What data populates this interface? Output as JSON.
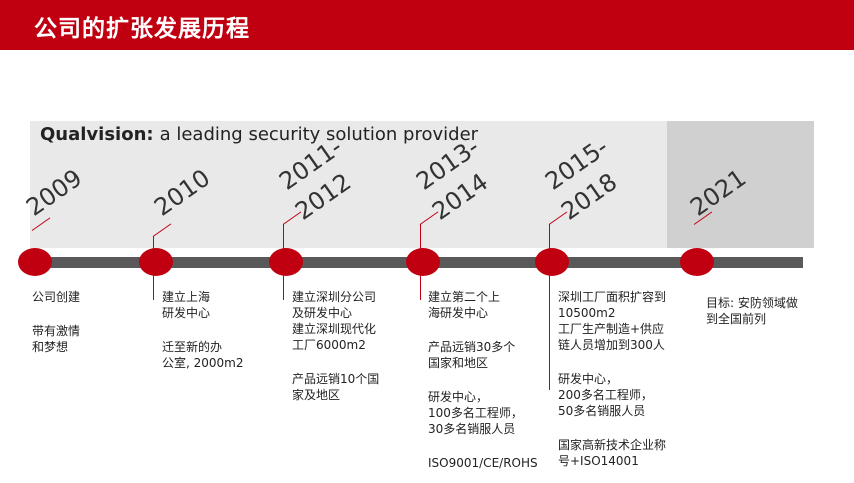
{
  "header": {
    "title": "公司的扩张发展历程"
  },
  "tagline": {
    "brand": "Qualvision:",
    "text": "a leading security solution provider"
  },
  "colors": {
    "accent": "#c00010",
    "axis": "#595959",
    "band_light": "#e9e9e9",
    "band_dark": "#d0d0d0"
  },
  "milestones": [
    {
      "year_line1": "2009",
      "year_line2": "",
      "groups": [
        [
          "公司创建"
        ],
        [
          "带有激情",
          "和梦想"
        ]
      ]
    },
    {
      "year_line1": "2010",
      "year_line2": "",
      "groups": [
        [
          "建立上海",
          "研发中心"
        ],
        [
          "迁至新的办",
          "公室, 2000m2"
        ]
      ]
    },
    {
      "year_line1": "2011-",
      "year_line2": "2012",
      "groups": [
        [
          "建立深圳分公司",
          "及研发中心",
          "建立深圳现代化",
          "工厂6000m2"
        ],
        [
          "产品远销10个国",
          "家及地区"
        ]
      ]
    },
    {
      "year_line1": "2013-",
      "year_line2": "2014",
      "groups": [
        [
          "建立第二个上",
          "海研发中心"
        ],
        [
          "产品远销30多个",
          "国家和地区"
        ],
        [
          "研发中心，",
          "100多名工程师，",
          "30多名销服人员"
        ],
        [
          "ISO9001/CE/ROHS"
        ]
      ]
    },
    {
      "year_line1": "2015-",
      "year_line2": "2018",
      "groups": [
        [
          "深圳工厂面积扩容到",
          "10500m2",
          " 工厂生产制造+供应",
          "链人员增加到300人"
        ],
        [
          "研发中心，",
          "200多名工程师，",
          "50多名销服人员"
        ],
        [
          "国家高新技术企业称",
          "号+ISO14001"
        ]
      ]
    },
    {
      "year_line1": "2021",
      "year_line2": "",
      "groups": [
        [
          "目标: 安防领域做",
          "到全国前列"
        ]
      ]
    }
  ]
}
